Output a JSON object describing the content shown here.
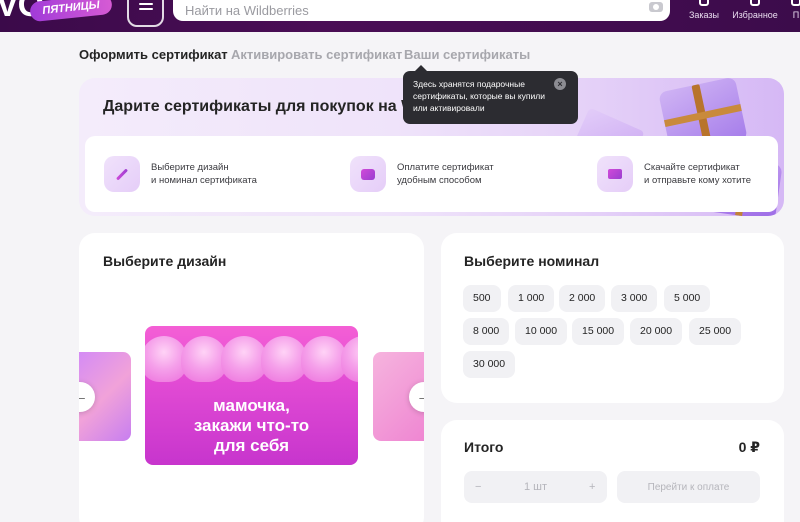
{
  "header": {
    "logo_text": "VO",
    "badge_text": "ПЯТНИЦЫ",
    "search_placeholder": "Найти на Wildberries",
    "nav": [
      {
        "label": "Заказы",
        "icon": "box-icon"
      },
      {
        "label": "Избранное",
        "icon": "heart-icon"
      },
      {
        "label": "П",
        "icon": "cart-icon"
      }
    ]
  },
  "tabs": [
    {
      "label": "Оформить сертификат",
      "active": true
    },
    {
      "label": "Активировать сертификат",
      "active": false
    },
    {
      "label": "Ваши сертификаты",
      "active": false
    }
  ],
  "tooltip": {
    "text": "Здесь хранятся подарочные сертификаты, которые вы купили или активировали",
    "close": "×"
  },
  "banner": {
    "title": "Дарите сертификаты для покупок на Wildberries",
    "steps": [
      {
        "line1": "Выберите дизайн",
        "line2": "и номинал сертификата",
        "icon": "magic-wand-icon"
      },
      {
        "line1": "Оплатите сертификат",
        "line2": "удобным способом",
        "icon": "wallet-icon"
      },
      {
        "line1": "Скачайте сертификат",
        "line2": "и отправьте кому хотите",
        "icon": "envelope-icon"
      }
    ]
  },
  "design": {
    "title": "Выберите дизайн",
    "card_text_lines": [
      "мамочка,",
      "закажи что-то",
      "для себя"
    ],
    "prev_arrow": "←",
    "next_arrow": "→"
  },
  "nominal": {
    "title": "Выберите номинал",
    "options": [
      "500",
      "1 000",
      "2 000",
      "3 000",
      "5 000",
      "8 000",
      "10 000",
      "15 000",
      "20 000",
      "25 000",
      "30 000"
    ]
  },
  "total": {
    "label": "Итого",
    "amount": "0 ₽",
    "minus": "−",
    "quantity": "1 шт",
    "plus": "+",
    "pay_label": "Перейти к оплате"
  },
  "colors": {
    "header_bg": "#3b0a4a",
    "accent": "#cb11ab",
    "chip_bg": "#f1f1f4",
    "tooltip_bg": "#2c2c31"
  }
}
